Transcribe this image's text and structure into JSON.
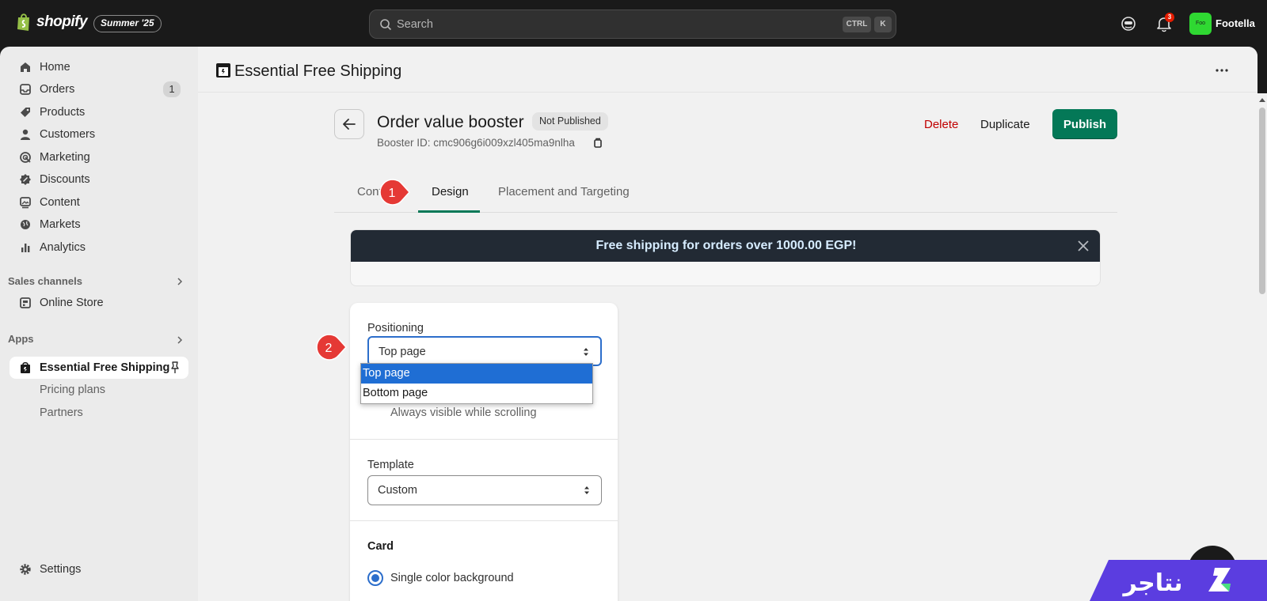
{
  "topbar": {
    "brand": "shopify",
    "edition": "Summer '25",
    "search": {
      "placeholder": "Search",
      "shortcut_1": "CTRL",
      "shortcut_2": "K"
    },
    "notification_count": "3",
    "avatar_initials": "Foo",
    "store_name": "Footella"
  },
  "sidebar": {
    "items": [
      {
        "label": "Home",
        "icon": "home-icon"
      },
      {
        "label": "Orders",
        "icon": "inbox-icon",
        "badge": "1"
      },
      {
        "label": "Products",
        "icon": "tag-icon"
      },
      {
        "label": "Customers",
        "icon": "person-icon"
      },
      {
        "label": "Marketing",
        "icon": "target-icon"
      },
      {
        "label": "Discounts",
        "icon": "discount-icon"
      },
      {
        "label": "Content",
        "icon": "image-icon"
      },
      {
        "label": "Markets",
        "icon": "globe-icon"
      },
      {
        "label": "Analytics",
        "icon": "bar-chart-icon"
      }
    ],
    "sales_channels_header": "Sales channels",
    "online_store": "Online Store",
    "apps_header": "Apps",
    "app_active": "Essential Free Shipping",
    "app_subitems": [
      "Pricing plans",
      "Partners"
    ],
    "settings": "Settings"
  },
  "app_header": {
    "title": "Essential Free Shipping"
  },
  "page": {
    "title": "Order value booster",
    "status": "Not Published",
    "booster_id": "Booster ID: cmc906g6i009xzl405ma9nlha",
    "actions": {
      "delete": "Delete",
      "duplicate": "Duplicate",
      "publish": "Publish"
    },
    "tabs": [
      "Content",
      "Design",
      "Placement and Targeting"
    ],
    "active_tab": "Design"
  },
  "preview": {
    "message": "Free shipping for orders over 1000.00 EGP!"
  },
  "settings_card": {
    "positioning_label": "Positioning",
    "positioning_value": "Top page",
    "positioning_options": [
      "Top page",
      "Bottom page"
    ],
    "helper_text": "Always visible while scrolling",
    "template_label": "Template",
    "template_value": "Custom",
    "card_heading": "Card",
    "card_option": "Single color background"
  },
  "callouts": [
    "1",
    "2"
  ],
  "colors": {
    "publish": "#047857",
    "delete": "#c00000",
    "banner_bg": "#222a34",
    "callout": "#e53935",
    "dropdown_selected": "#1f6ed4"
  }
}
